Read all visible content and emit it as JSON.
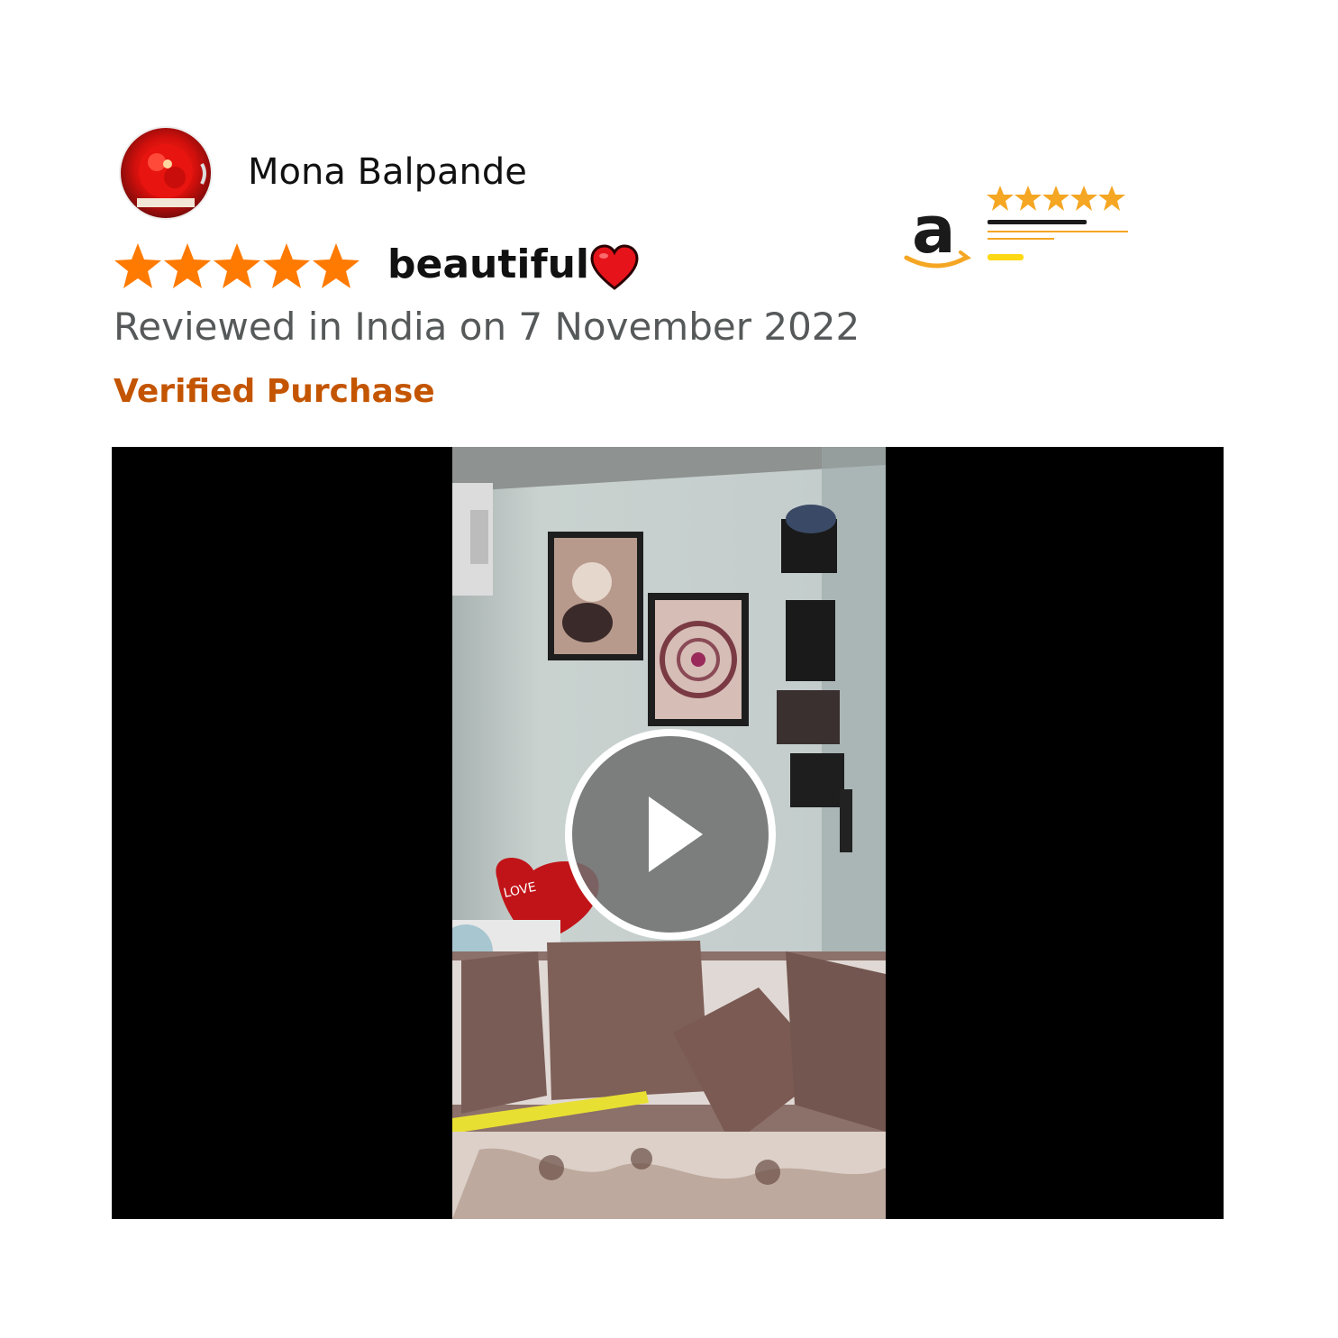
{
  "review": {
    "reviewer_name": "Mona Balpande",
    "rating": 5,
    "rating_max": 5,
    "title": "beautiful",
    "date": "Reviewed in India on 7 November 2022",
    "verified": "Verified Purchase"
  },
  "brand": {
    "logo_letter": "a",
    "stars": 5
  },
  "video": {
    "icon": "play-icon"
  },
  "colors": {
    "star": "#ff7a00",
    "verified": "#c45500",
    "date": "#565959",
    "brand_star": "#f5a623",
    "brand_bar": "#ffd814"
  }
}
